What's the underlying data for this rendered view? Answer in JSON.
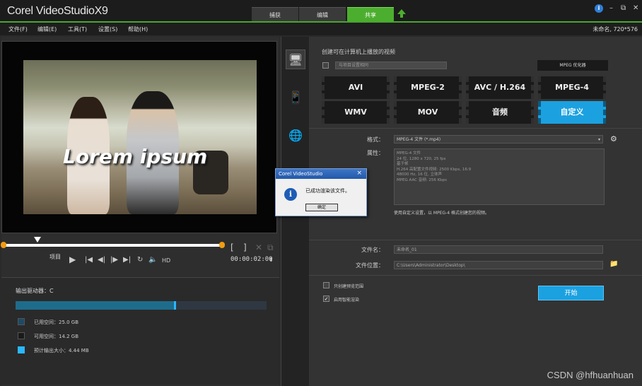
{
  "app": {
    "title": "Corel VideoStudioX9"
  },
  "tabs": [
    {
      "label": "捕获"
    },
    {
      "label": "编辑"
    },
    {
      "label": "共享"
    }
  ],
  "menu": [
    {
      "label": "文件(F)"
    },
    {
      "label": "编辑(E)"
    },
    {
      "label": "工具(T)"
    },
    {
      "label": "设置(S)"
    },
    {
      "label": "帮助(H)"
    }
  ],
  "project_info": "未命名, 720*576",
  "preview": {
    "overlay_text": "Lorem ipsum",
    "project_label": "项目",
    "timecode": "00:00:02:00"
  },
  "output": {
    "drive_label": "输出驱动器：C",
    "usage_fraction": 0.63,
    "legend": [
      {
        "label": "已用空间：",
        "value": "25.0 GB",
        "color": "#1e4a66"
      },
      {
        "label": "可用空间：",
        "value": "14.2 GB",
        "color": "#1a1a1a"
      },
      {
        "label": "预计输出大小：",
        "value": "4.44 MB",
        "color": "#2ab7ff"
      }
    ]
  },
  "share": {
    "heading": "创建可在计算机上播放的视频",
    "profile_dropdown": "与项目设置相同",
    "mpeg_optimizer": "MPEG 优化器",
    "formats": [
      {
        "label": "AVI"
      },
      {
        "label": "MPEG-2"
      },
      {
        "label": "AVC / H.264"
      },
      {
        "label": "MPEG-4"
      },
      {
        "label": "WMV"
      },
      {
        "label": "MOV"
      },
      {
        "label": "音频"
      },
      {
        "label": "自定义"
      }
    ],
    "format_label": "格式：",
    "format_value": "MPEG-4 文件 (*.mp4)",
    "properties_label": "属性：",
    "properties": [
      "MPEG-4 文件",
      "24 位, 1280 x 720, 25 fps",
      "基于帧",
      "H.264 高配置文件视频: 2500 Kbps, 16:9",
      "48000 Hz, 16 位, 立体声",
      "MPEG AAC 音频: 256 Kbps"
    ],
    "properties_note": "使用自定义设置，以 MPEG-4 格式创建您的视频。",
    "filename_label": "文件名：",
    "filename_value": "未命名_01",
    "location_label": "文件位置：",
    "location_value": "C:\\Users\\Administrator\\Desktop\\",
    "only_preview_label": "只创建预览范围",
    "smart_render_label": "启用智能渲染",
    "start_button": "开始"
  },
  "dialog": {
    "title": "Corel VideoStudio",
    "message": "已成功渲染该文件。",
    "ok": "确定",
    "close": "×"
  },
  "watermark": "CSDN @hfhuanhuan"
}
